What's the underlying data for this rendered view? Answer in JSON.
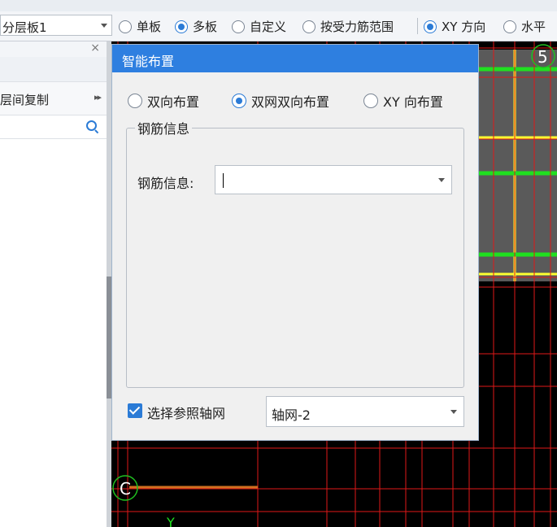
{
  "toolbar": {
    "layer_combo_value": "分层板1",
    "radios": [
      {
        "label": "单板",
        "selected": false
      },
      {
        "label": "多板",
        "selected": true
      },
      {
        "label": "自定义",
        "selected": false
      },
      {
        "label": "按受力筋范围",
        "selected": false
      },
      {
        "label": "XY 方向",
        "selected": true
      },
      {
        "label": "水平",
        "selected": false
      }
    ]
  },
  "left_panel": {
    "close_glyph": "×",
    "item_label": "层间复制",
    "item_more": "▸▸"
  },
  "dialog": {
    "title": "智能布置",
    "radios": [
      {
        "label": "双向布置",
        "selected": false
      },
      {
        "label": "双网双向布置",
        "selected": true
      },
      {
        "label": "XY 向布置",
        "selected": false
      }
    ],
    "group_legend": "钢筋信息",
    "field_label": "钢筋信息:",
    "field_value": "",
    "checkbox_label": "选择参照轴网",
    "checkbox_checked": true,
    "axis_value": "轴网-2"
  },
  "canvas": {
    "label_5": "5",
    "label_c": "C",
    "label_y": "Y",
    "colors": {
      "red": "#e01818",
      "yellow": "#ffff30",
      "green": "#20e020",
      "grey_block": "#5a5a5a",
      "bubble_green": "#20c020"
    }
  }
}
